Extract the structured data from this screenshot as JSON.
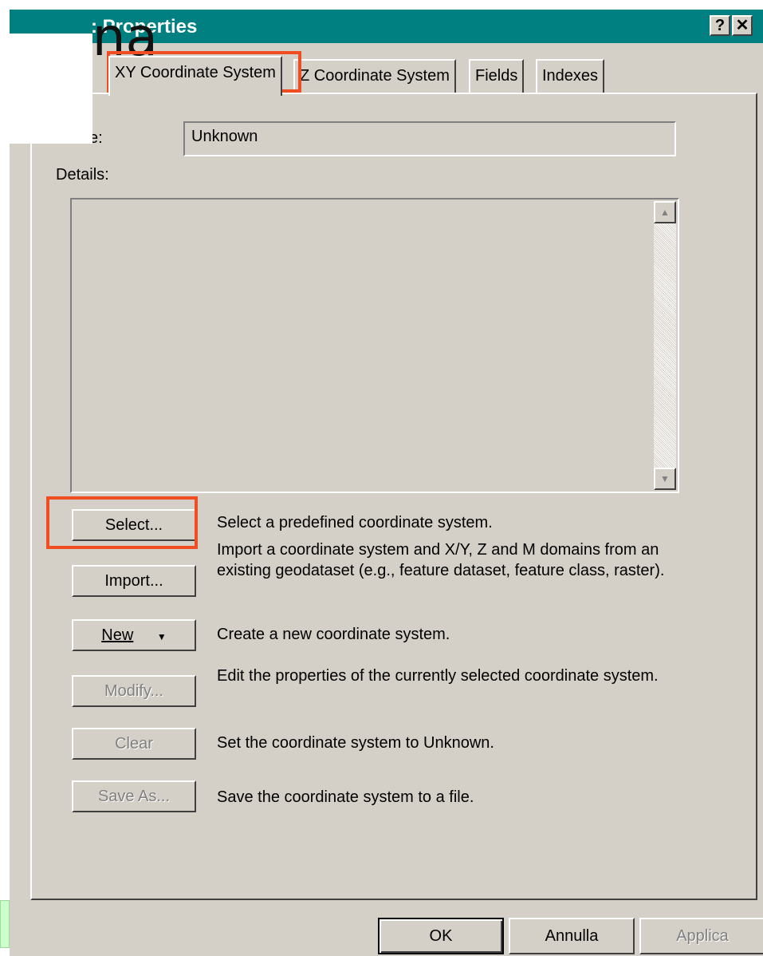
{
  "overlay_text": "na",
  "window": {
    "title": ": Properties",
    "help_label": "?",
    "close_label": "✕"
  },
  "tabs": [
    {
      "label": "XY Coordinate System",
      "active": true
    },
    {
      "label": "Z Coordinate System",
      "active": false
    },
    {
      "label": "Fields",
      "active": false
    },
    {
      "label": "Indexes",
      "active": false
    }
  ],
  "name_field": {
    "label": "e:",
    "value": "Unknown"
  },
  "details": {
    "label": "Details:"
  },
  "actions": [
    {
      "button": "Select...",
      "desc": "Select a predefined coordinate system.",
      "enabled": true
    },
    {
      "button": "Import...",
      "desc": "Import a coordinate system and X/Y, Z and M domains from an existing geodataset (e.g., feature dataset, feature class, raster).",
      "enabled": true
    },
    {
      "button": "New",
      "desc": "Create a new coordinate system.",
      "enabled": true
    },
    {
      "button": "Modify...",
      "desc": "Edit the properties of the currently selected coordinate system.",
      "enabled": false
    },
    {
      "button": "Clear",
      "desc": "Set the coordinate system to Unknown.",
      "enabled": false
    },
    {
      "button": "Save As...",
      "desc": "Save the coordinate system to a file.",
      "enabled": false
    }
  ],
  "footer": {
    "ok": "OK",
    "cancel": "Annulla",
    "apply": "Applica"
  },
  "icons": {
    "dropdown": "chevron-down-icon",
    "scroll_up": "arrow-up-icon",
    "scroll_down": "arrow-down-icon"
  },
  "colors": {
    "titlebar": "#008080",
    "highlight": "#f04d23",
    "dialog_bg": "#d4d0c8"
  }
}
